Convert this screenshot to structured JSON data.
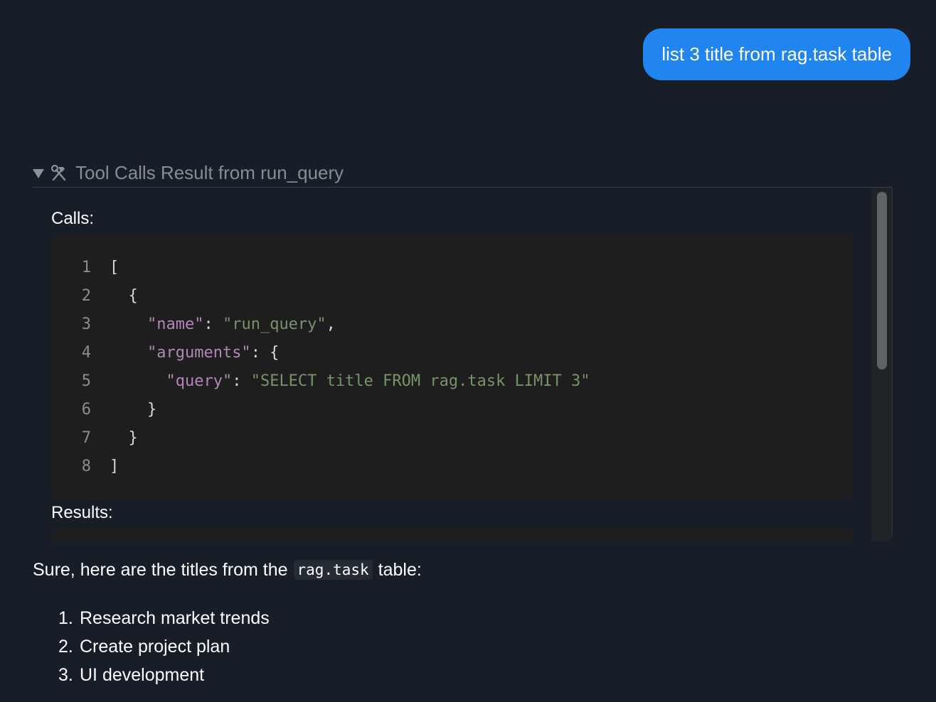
{
  "user_message": "list 3 title from rag.task table",
  "tool_calls": {
    "summary": "Tool Calls Result from run_query",
    "calls_label": "Calls:",
    "results_label": "Results:",
    "code_lines": [
      {
        "no": "1",
        "tokens": [
          {
            "t": "[",
            "c": "punc"
          }
        ]
      },
      {
        "no": "2",
        "tokens": [
          {
            "t": "  {",
            "c": "punc"
          }
        ]
      },
      {
        "no": "3",
        "tokens": [
          {
            "t": "    ",
            "c": "punc"
          },
          {
            "t": "\"name\"",
            "c": "key"
          },
          {
            "t": ": ",
            "c": "punc"
          },
          {
            "t": "\"run_query\"",
            "c": "str"
          },
          {
            "t": ",",
            "c": "punc"
          }
        ]
      },
      {
        "no": "4",
        "tokens": [
          {
            "t": "    ",
            "c": "punc"
          },
          {
            "t": "\"arguments\"",
            "c": "key"
          },
          {
            "t": ": {",
            "c": "punc"
          }
        ]
      },
      {
        "no": "5",
        "tokens": [
          {
            "t": "      ",
            "c": "punc"
          },
          {
            "t": "\"query\"",
            "c": "key"
          },
          {
            "t": ": ",
            "c": "punc"
          },
          {
            "t": "\"SELECT title FROM rag.task LIMIT 3\"",
            "c": "str"
          }
        ]
      },
      {
        "no": "6",
        "tokens": [
          {
            "t": "    }",
            "c": "punc"
          }
        ]
      },
      {
        "no": "7",
        "tokens": [
          {
            "t": "  }",
            "c": "punc"
          }
        ]
      },
      {
        "no": "8",
        "tokens": [
          {
            "t": "]",
            "c": "punc"
          }
        ]
      }
    ]
  },
  "reply": {
    "intro_before": "Sure, here are the titles from the",
    "intro_code": "rag.task",
    "intro_after": "table:",
    "items": [
      {
        "num": "1.",
        "text": "Research market trends"
      },
      {
        "num": "2.",
        "text": "Create project plan"
      },
      {
        "num": "3.",
        "text": "UI development"
      }
    ]
  },
  "colors": {
    "background": "#171e27",
    "user_bubble": "#2185ef",
    "code_bg": "#1e1e1e",
    "json_key": "#b386b9",
    "json_string": "#77936a"
  },
  "icons": {
    "collapse": "triangle-down-icon",
    "tools": "hammer-wrench-icon"
  }
}
